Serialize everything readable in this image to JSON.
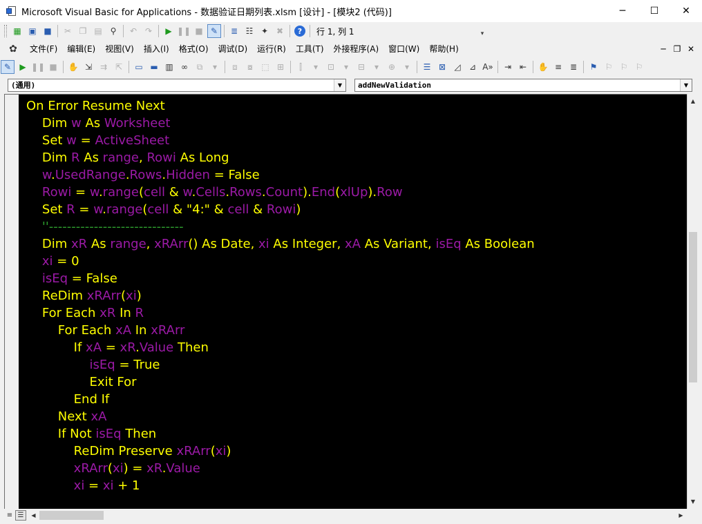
{
  "window": {
    "title": "Microsoft Visual Basic for Applications - 数据验证日期列表.xlsm [设计] - [模块2 (代码)]",
    "minimize_glyph": "─",
    "maximize_glyph": "☐",
    "close_glyph": "✕"
  },
  "standard_toolbar": {
    "position_label": "行 1, 列 1"
  },
  "menu": {
    "items": [
      "文件(F)",
      "编辑(E)",
      "视图(V)",
      "插入(I)",
      "格式(O)",
      "调试(D)",
      "运行(R)",
      "工具(T)",
      "外接程序(A)",
      "窗口(W)",
      "帮助(H)"
    ]
  },
  "combos": {
    "object_value": "(通用)",
    "procedure_value": "addNewValidation"
  },
  "colors": {
    "editor_background": "#000000",
    "keyword": "#ffff00",
    "identifier": "#9b1aa6",
    "comment": "#2e9e2e"
  },
  "code_lines": [
    [
      [
        "k",
        "On Error Resume Next"
      ]
    ],
    [
      [
        "t",
        "    "
      ],
      [
        "k",
        "Dim "
      ],
      [
        "v",
        "w"
      ],
      [
        "k",
        " As "
      ],
      [
        "v",
        "Worksheet"
      ]
    ],
    [
      [
        "t",
        "    "
      ],
      [
        "k",
        "Set "
      ],
      [
        "v",
        "w"
      ],
      [
        "o",
        " = "
      ],
      [
        "v",
        "ActiveSheet"
      ]
    ],
    [
      [
        "t",
        "    "
      ],
      [
        "k",
        "Dim "
      ],
      [
        "v",
        "R"
      ],
      [
        "k",
        " As "
      ],
      [
        "v",
        "range"
      ],
      [
        "o",
        ", "
      ],
      [
        "v",
        "Rowi"
      ],
      [
        "k",
        " As Long"
      ]
    ],
    [
      [
        "t",
        "    "
      ],
      [
        "v",
        "w"
      ],
      [
        "o",
        "."
      ],
      [
        "v",
        "UsedRange"
      ],
      [
        "o",
        "."
      ],
      [
        "v",
        "Rows"
      ],
      [
        "o",
        "."
      ],
      [
        "v",
        "Hidden"
      ],
      [
        "o",
        " = "
      ],
      [
        "k",
        "False"
      ]
    ],
    [
      [
        "t",
        "    "
      ],
      [
        "v",
        "Rowi"
      ],
      [
        "o",
        " = "
      ],
      [
        "v",
        "w"
      ],
      [
        "o",
        "."
      ],
      [
        "v",
        "range"
      ],
      [
        "o",
        "("
      ],
      [
        "v",
        "cell"
      ],
      [
        "o",
        " & "
      ],
      [
        "v",
        "w"
      ],
      [
        "o",
        "."
      ],
      [
        "v",
        "Cells"
      ],
      [
        "o",
        "."
      ],
      [
        "v",
        "Rows"
      ],
      [
        "o",
        "."
      ],
      [
        "v",
        "Count"
      ],
      [
        "o",
        ")."
      ],
      [
        "v",
        "End"
      ],
      [
        "o",
        "("
      ],
      [
        "v",
        "xlUp"
      ],
      [
        "o",
        ")."
      ],
      [
        "v",
        "Row"
      ]
    ],
    [
      [
        "t",
        "    "
      ],
      [
        "k",
        "Set "
      ],
      [
        "v",
        "R"
      ],
      [
        "o",
        " = "
      ],
      [
        "v",
        "w"
      ],
      [
        "o",
        "."
      ],
      [
        "v",
        "range"
      ],
      [
        "o",
        "("
      ],
      [
        "v",
        "cell"
      ],
      [
        "o",
        " & "
      ],
      [
        "t",
        "\"4:\""
      ],
      [
        "o",
        " & "
      ],
      [
        "v",
        "cell"
      ],
      [
        "o",
        " & "
      ],
      [
        "v",
        "Rowi"
      ],
      [
        "o",
        ")"
      ]
    ],
    [
      [
        "t",
        "    "
      ],
      [
        "c",
        "''------------------------------"
      ]
    ],
    [
      [
        "t",
        "    "
      ],
      [
        "k",
        "Dim "
      ],
      [
        "v",
        "xR"
      ],
      [
        "k",
        " As "
      ],
      [
        "v",
        "range"
      ],
      [
        "o",
        ", "
      ],
      [
        "v",
        "xRArr"
      ],
      [
        "o",
        "() "
      ],
      [
        "k",
        "As Date"
      ],
      [
        "o",
        ", "
      ],
      [
        "v",
        "xi"
      ],
      [
        "k",
        " As Integer"
      ],
      [
        "o",
        ", "
      ],
      [
        "v",
        "xA"
      ],
      [
        "k",
        " As Variant"
      ],
      [
        "o",
        ", "
      ],
      [
        "v",
        "isEq"
      ],
      [
        "k",
        " As Boolean"
      ]
    ],
    [
      [
        "t",
        "    "
      ],
      [
        "v",
        "xi"
      ],
      [
        "o",
        " = "
      ],
      [
        "t",
        "0"
      ]
    ],
    [
      [
        "t",
        "    "
      ],
      [
        "v",
        "isEq"
      ],
      [
        "o",
        " = "
      ],
      [
        "k",
        "False"
      ]
    ],
    [
      [
        "t",
        "    "
      ],
      [
        "k",
        "ReDim "
      ],
      [
        "v",
        "xRArr"
      ],
      [
        "o",
        "("
      ],
      [
        "v",
        "xi"
      ],
      [
        "o",
        ")"
      ]
    ],
    [
      [
        "t",
        "    "
      ],
      [
        "k",
        "For Each "
      ],
      [
        "v",
        "xR"
      ],
      [
        "k",
        " In "
      ],
      [
        "v",
        "R"
      ]
    ],
    [
      [
        "t",
        "        "
      ],
      [
        "k",
        "For Each "
      ],
      [
        "v",
        "xA"
      ],
      [
        "k",
        " In "
      ],
      [
        "v",
        "xRArr"
      ]
    ],
    [
      [
        "t",
        "            "
      ],
      [
        "k",
        "If "
      ],
      [
        "v",
        "xA"
      ],
      [
        "o",
        " = "
      ],
      [
        "v",
        "xR"
      ],
      [
        "o",
        "."
      ],
      [
        "v",
        "Value"
      ],
      [
        "k",
        " Then"
      ]
    ],
    [
      [
        "t",
        "                "
      ],
      [
        "v",
        "isEq"
      ],
      [
        "o",
        " = "
      ],
      [
        "k",
        "True"
      ]
    ],
    [
      [
        "t",
        "                "
      ],
      [
        "k",
        "Exit For"
      ]
    ],
    [
      [
        "t",
        "            "
      ],
      [
        "k",
        "End If"
      ]
    ],
    [
      [
        "t",
        "        "
      ],
      [
        "k",
        "Next "
      ],
      [
        "v",
        "xA"
      ]
    ],
    [
      [
        "t",
        "        "
      ],
      [
        "k",
        "If Not "
      ],
      [
        "v",
        "isEq"
      ],
      [
        "k",
        " Then"
      ]
    ],
    [
      [
        "t",
        "            "
      ],
      [
        "k",
        "ReDim Preserve "
      ],
      [
        "v",
        "xRArr"
      ],
      [
        "o",
        "("
      ],
      [
        "v",
        "xi"
      ],
      [
        "o",
        ")"
      ]
    ],
    [
      [
        "t",
        "            "
      ],
      [
        "v",
        "xRArr"
      ],
      [
        "o",
        "("
      ],
      [
        "v",
        "xi"
      ],
      [
        "o",
        ") = "
      ],
      [
        "v",
        "xR"
      ],
      [
        "o",
        "."
      ],
      [
        "v",
        "Value"
      ]
    ],
    [
      [
        "t",
        "            "
      ],
      [
        "v",
        "xi"
      ],
      [
        "o",
        " = "
      ],
      [
        "v",
        "xi"
      ],
      [
        "o",
        " + "
      ],
      [
        "t",
        "1"
      ]
    ]
  ]
}
